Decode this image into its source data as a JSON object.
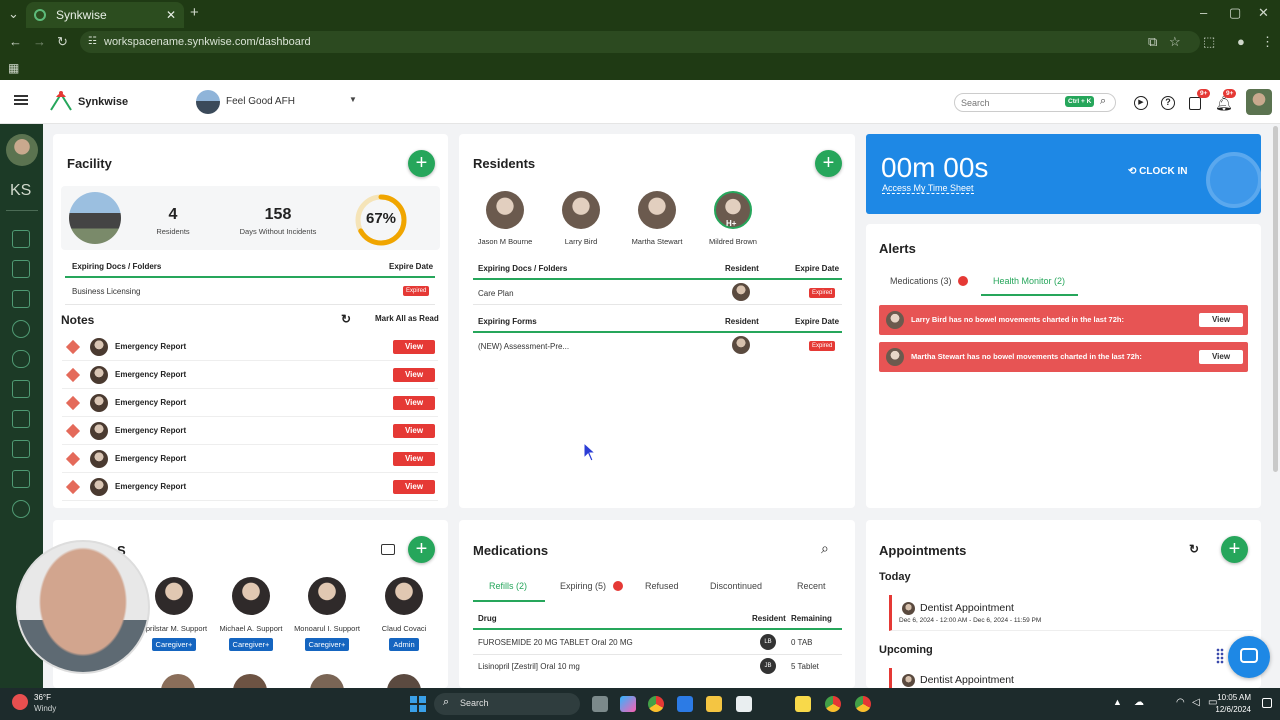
{
  "browser": {
    "tab_title": "Synkwise",
    "url": "workspacename.synkwise.com/dashboard"
  },
  "header": {
    "brand": "Synkwise",
    "facility_name": "Feel Good AFH",
    "search_placeholder": "Search",
    "shortcut": "Ctrl + K",
    "badge_cart": "9+",
    "badge_bell": "9+"
  },
  "sidebar": {
    "initials": "KS"
  },
  "facility": {
    "title": "Facility",
    "residents_count": "4",
    "residents_label": "Residents",
    "days_count": "158",
    "days_label": "Days Without Incidents",
    "percent": "67%",
    "percent_value": 67,
    "docs_header": "Expiring Docs / Folders",
    "expire_header": "Expire Date",
    "docs": [
      {
        "name": "Business Licensing",
        "status": "Expired"
      }
    ]
  },
  "notes": {
    "title": "Notes",
    "mark_all": "Mark All as Read",
    "items": [
      {
        "label": "Emergency Report",
        "action": "View"
      },
      {
        "label": "Emergency Report",
        "action": "View"
      },
      {
        "label": "Emergency Report",
        "action": "View"
      },
      {
        "label": "Emergency Report",
        "action": "View"
      },
      {
        "label": "Emergency Report",
        "action": "View"
      },
      {
        "label": "Emergency Report",
        "action": "View"
      }
    ]
  },
  "residents": {
    "title": "Residents",
    "people": [
      {
        "name": "Jason M Bourne"
      },
      {
        "name": "Larry Bird"
      },
      {
        "name": "Martha Stewart"
      },
      {
        "name": "Mildred Brown",
        "badge": "H+"
      }
    ],
    "docs_header": "Expiring Docs / Folders",
    "resident_header": "Resident",
    "expire_header": "Expire Date",
    "docs": [
      {
        "name": "Care Plan",
        "status": "Expired"
      }
    ],
    "forms_header": "Expiring Forms",
    "forms": [
      {
        "name": "(NEW) Assessment-Pre...",
        "status": "Expired"
      }
    ]
  },
  "clock": {
    "time": "00m 00s",
    "link": "Access My Time Sheet",
    "action": "CLOCK IN"
  },
  "alerts": {
    "title": "Alerts",
    "tabs": [
      {
        "label": "Medications (3)"
      },
      {
        "label": "Health Monitor (2)"
      }
    ],
    "items": [
      {
        "text": "Larry Bird has no bowel movements charted in the last 72h:",
        "action": "View"
      },
      {
        "text": "Martha Stewart has no bowel movements charted in the last 72h:",
        "action": "View"
      }
    ]
  },
  "staff": {
    "title": "S",
    "people": [
      {
        "name": "Aprilstar M. Support",
        "role": "Caregiver+"
      },
      {
        "name": "Michael A. Support",
        "role": "Caregiver+"
      },
      {
        "name": "Monoarul I. Support",
        "role": "Caregiver+"
      },
      {
        "name": "Claud Covaci",
        "role": "Admin"
      }
    ]
  },
  "medications": {
    "title": "Medications",
    "tabs": [
      "Refills (2)",
      "Expiring (5)",
      "Refused",
      "Discontinued",
      "Recent"
    ],
    "columns": [
      "Drug",
      "Resident",
      "Remaining"
    ],
    "rows": [
      {
        "drug": "FUROSEMIDE 20 MG TABLET Oral 20 MG",
        "resident": "LB",
        "remaining": "0 TAB"
      },
      {
        "drug": "Lisinopril [Zestril] Oral 10 mg",
        "resident": "JB",
        "remaining": "5 Tablet"
      }
    ]
  },
  "appointments": {
    "title": "Appointments",
    "today_label": "Today",
    "upcoming_label": "Upcoming",
    "today": [
      {
        "title": "Dentist Appointment",
        "time": "Dec 6, 2024 - 12:00 AM - Dec 6, 2024 - 11:59 PM"
      }
    ],
    "upcoming": [
      {
        "title": "Dentist Appointment"
      }
    ]
  },
  "taskbar": {
    "temp": "36°F",
    "weather": "Windy",
    "search": "Search",
    "time": "10:05 AM",
    "date": "12/6/2024"
  },
  "colors": {
    "brand_green": "#26a65b",
    "alert_red": "#e75454",
    "clock_blue": "#1e88e5",
    "sidebar_dark": "#1c3a26"
  }
}
